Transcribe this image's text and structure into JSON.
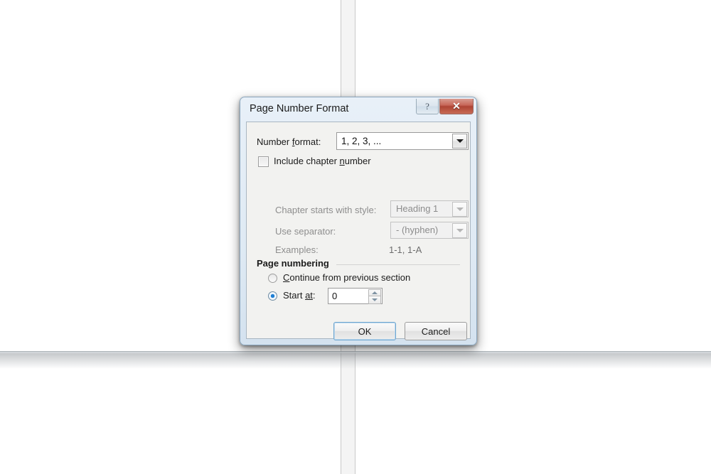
{
  "background": {
    "kind": "document-page-edge"
  },
  "dialog": {
    "title": "Page Number Format",
    "window_buttons": {
      "help_label": "?",
      "help_icon": "question-mark-icon",
      "close_label": "✕",
      "close_icon": "close-x-icon"
    },
    "number_format": {
      "label_prefix": "Number ",
      "label_accel": "f",
      "label_suffix": "ormat:",
      "label_full": "Number format:",
      "value": "1, 2, 3, ...",
      "dropdown_icon": "chevron-down-icon",
      "enabled": true
    },
    "include_chapter": {
      "label_prefix": "Include chapter ",
      "label_accel": "n",
      "label_suffix": "umber",
      "label_full": "Include chapter number",
      "checked": false
    },
    "chapter_style": {
      "label": "Chapter starts with style:",
      "value": "Heading 1",
      "dropdown_icon": "chevron-down-icon",
      "enabled": false
    },
    "separator": {
      "label": "Use separator:",
      "value": "-   (hyphen)",
      "dropdown_icon": "chevron-down-icon",
      "enabled": false
    },
    "examples": {
      "label": "Examples:",
      "value": "1-1, 1-A"
    },
    "page_numbering": {
      "legend": "Page numbering",
      "continue_option": {
        "label_prefix": "",
        "label_accel": "C",
        "label_suffix": "ontinue from previous section",
        "label_full": "Continue from previous section",
        "selected": false
      },
      "start_at_option": {
        "label_prefix": "Start ",
        "label_accel": "at",
        "label_suffix": ":",
        "label_full": "Start at:",
        "selected": true
      },
      "start_at_value": "0",
      "spinner_up_icon": "spinner-up-arrow-icon",
      "spinner_down_icon": "spinner-down-arrow-icon"
    },
    "footer": {
      "ok_label": "OK",
      "cancel_label": "Cancel"
    },
    "colors": {
      "frame": "#8ba6bd",
      "client": "#f2f2f0",
      "close_button": "#ae4434",
      "radio_selected": "#1f7fd4",
      "default_button_outline": "#6fa6cf"
    }
  }
}
